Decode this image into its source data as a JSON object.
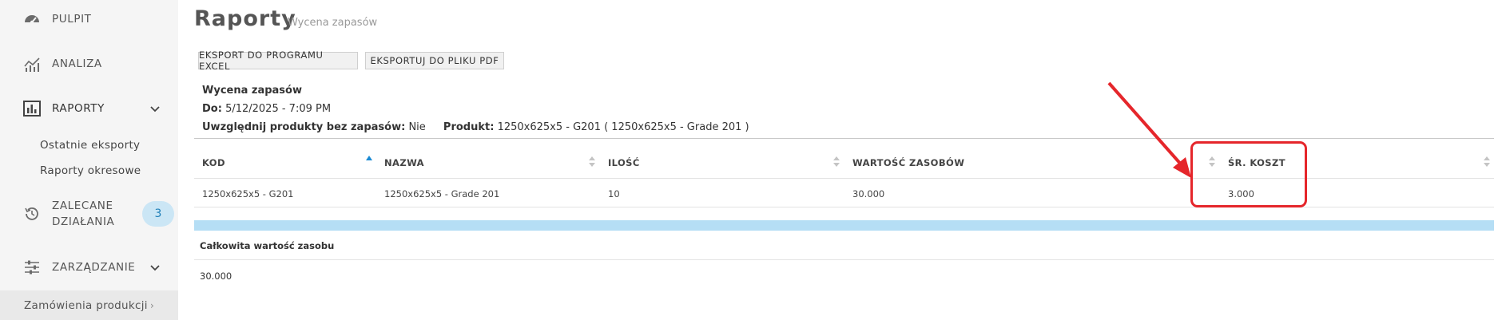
{
  "sidebar": {
    "items": [
      {
        "label": "PULPIT",
        "icon": "gauge-icon"
      },
      {
        "label": "ANALIZA",
        "icon": "line-chart-icon"
      },
      {
        "label": "RAPORTY",
        "icon": "bar-chart-icon",
        "expanded": true
      },
      {
        "label": "ZALECANE DZIAŁANIA",
        "line1": "ZALECANE",
        "line2": "DZIAŁANIA",
        "icon": "history-icon",
        "badge": "3"
      },
      {
        "label": "ZARZĄDZANIE",
        "icon": "sliders-icon"
      }
    ],
    "sub_items": [
      "Ostatnie eksporty",
      "Raporty okresowe"
    ],
    "bottom_item": {
      "label": "Zamówienia produkcji",
      "chevron": "›"
    }
  },
  "header": {
    "title": "Raporty",
    "subtitle": "Wycena zapasów"
  },
  "toolbar": {
    "excel_label": "EKSPORT DO PROGRAMU EXCEL",
    "pdf_label": "EKSPORTUJ DO PLIKU PDF"
  },
  "report_info": {
    "title": "Wycena zapasów",
    "date_label": "Do:",
    "date_value": "5/12/2025 - 7:09 PM",
    "include_label": "Uwzględnij produkty bez zapasów:",
    "include_value": "Nie",
    "product_label": "Produkt:",
    "product_value": "1250x625x5 - G201 ( 1250x625x5 - Grade 201 )"
  },
  "table": {
    "columns": [
      "KOD",
      "NAZWA",
      "ILOŚĆ",
      "WARTOŚĆ ZASOBÓW",
      "ŚR. KOSZT"
    ],
    "rows": [
      [
        "1250x625x5 - G201",
        "1250x625x5 - Grade 201",
        "10",
        "30.000",
        "3.000"
      ]
    ],
    "sorted_column": "KOD",
    "sort_direction": "ascending"
  },
  "totals": {
    "label": "Całkowita wartość zasobu",
    "value": "30.000"
  },
  "colors": {
    "sidebar_bg": "#f5f5f5",
    "accent_blue": "#b5def5",
    "sort_active": "#1a8ad4",
    "annotation_red": "#e5262b"
  }
}
